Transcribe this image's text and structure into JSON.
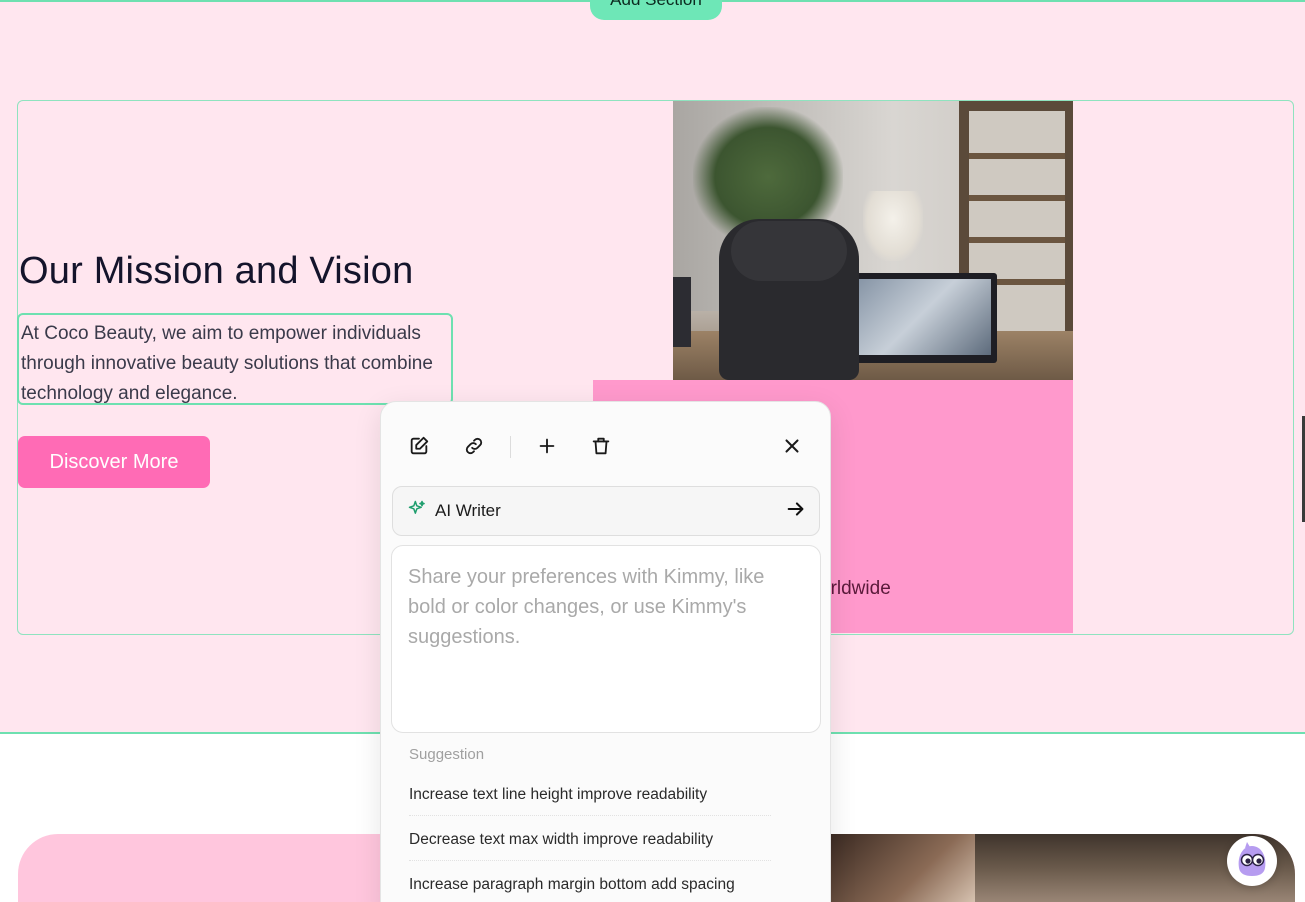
{
  "builder": {
    "add_section_label": "Add Section"
  },
  "hero": {
    "title": "Our Mission and Vision",
    "paragraph": "At Coco Beauty, we aim to empower individuals through innovative beauty solutions that combine technology and elegance.",
    "cta_label": "Discover More",
    "partial_text": "orldwide"
  },
  "editor_popup": {
    "tools": [
      "edit-icon",
      "link-icon",
      "plus-icon",
      "trash-icon",
      "close-icon"
    ],
    "ai_writer_label": "AI Writer",
    "prompt_placeholder": "Share your preferences with Kimmy, like bold or color changes, or use Kimmy's suggestions.",
    "suggestion_title": "Suggestion",
    "suggestions": [
      "Increase text line height improve readability",
      "Decrease text max width improve readability",
      "Increase paragraph margin bottom add spacing"
    ]
  },
  "colors": {
    "accent_green": "#6ee7b7",
    "pink_background": "#ffe6ef",
    "cta_pink": "#ff6bb5",
    "box_pink": "#ff99cc",
    "ai_icon_green": "#1f9e6e"
  },
  "assistant": {
    "icon": "kimmy-mascot-icon"
  }
}
